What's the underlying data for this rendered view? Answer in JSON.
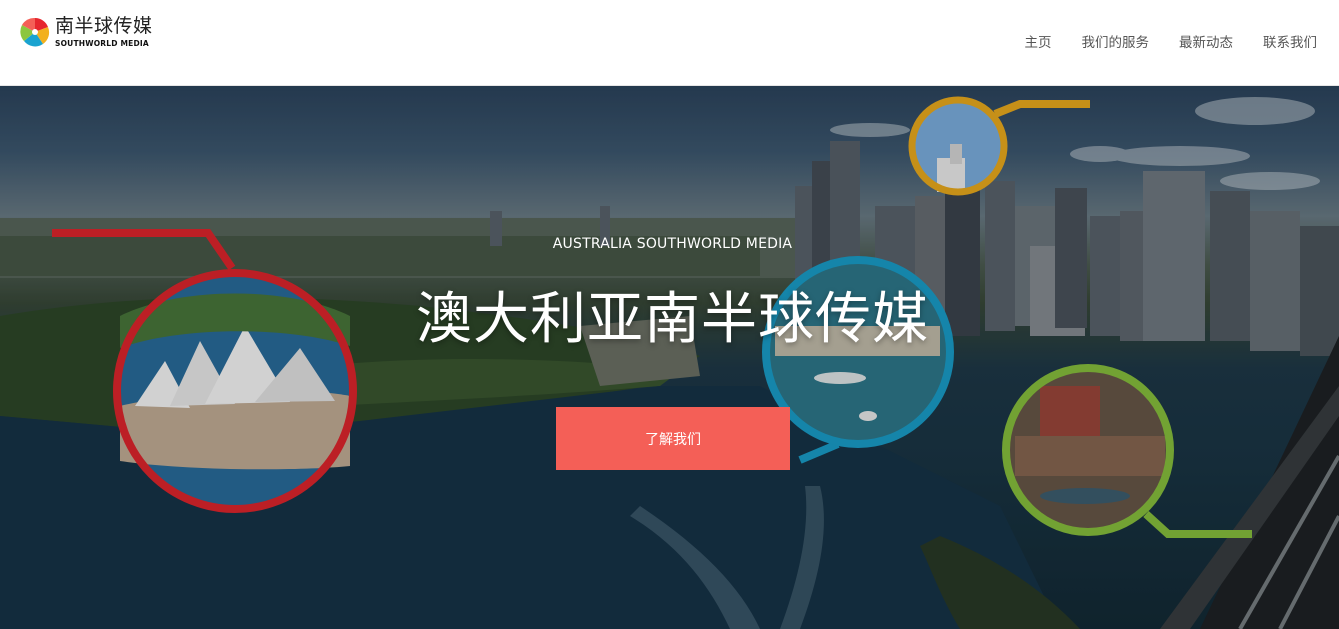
{
  "brand": {
    "name_cn": "南半球传媒",
    "name_en": "SOUTHWORLD MEDIA",
    "logo_icon": "pinwheel-logo-icon"
  },
  "nav": {
    "items": [
      {
        "label": "主页"
      },
      {
        "label": "我们的服务"
      },
      {
        "label": "最新动态"
      },
      {
        "label": "联系我们"
      }
    ]
  },
  "hero": {
    "subtitle": "AUSTRALIA SOUTHWORLD MEDIA",
    "title": "澳大利亚南半球传媒",
    "cta_label": "了解我们",
    "background": "sydney-harbour-aerial-photo",
    "callouts": [
      {
        "name": "opera-house-callout",
        "color": "#e6262e"
      },
      {
        "name": "tower-callout",
        "color": "#f2b01e"
      },
      {
        "name": "harbour-ferry-callout",
        "color": "#1aa3d0"
      },
      {
        "name": "rocks-district-callout",
        "color": "#8cc63f"
      }
    ]
  },
  "colors": {
    "accent": "#f45f57",
    "nav_text": "#555555"
  }
}
